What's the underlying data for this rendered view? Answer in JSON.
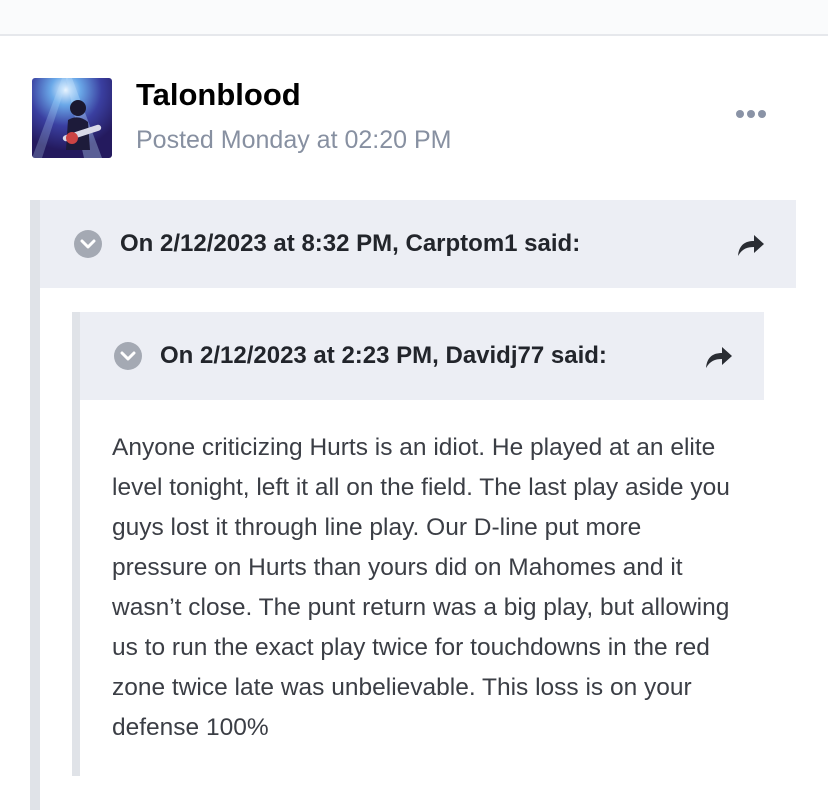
{
  "post": {
    "author": "Talonblood",
    "posted": "Posted Monday at 02:20 PM",
    "more_icon": "ellipsis-icon"
  },
  "quotes": {
    "outer": {
      "header": "On 2/12/2023 at 8:32 PM, Carptom1 said:",
      "toggle_icon": "chevron-down-icon",
      "share_icon": "share-arrow-icon"
    },
    "inner": {
      "header": "On 2/12/2023 at 2:23 PM, Davidj77 said:",
      "toggle_icon": "chevron-down-icon",
      "share_icon": "share-arrow-icon",
      "body": "Anyone criticizing Hurts is an idiot. He played at an elite level tonight, left it all on the field. The last play aside you guys lost it through line play. Our D-line put more pressure on Hurts than yours did on Mahomes and it wasn’t close. The punt return was a big play, but allowing us to run the exact play twice for touchdowns in the red zone twice late was unbelievable. This loss is on your defense 100%"
    }
  },
  "colors": {
    "quote_header_bg": "#eceef4",
    "quote_border": "#e0e3e8",
    "muted_text": "#8790a1"
  }
}
